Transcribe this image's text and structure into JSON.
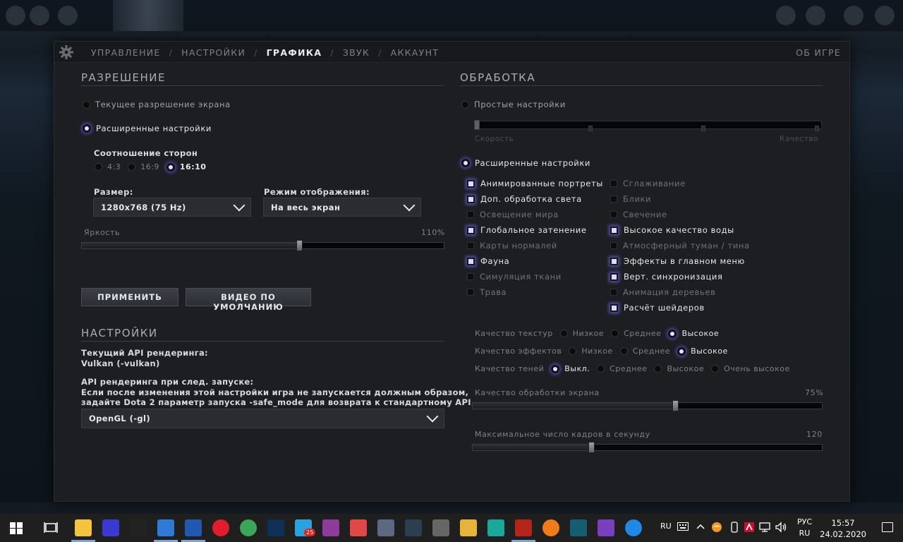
{
  "nav": {
    "tabs": [
      "УПРАВЛЕНИЕ",
      "НАСТРОЙКИ",
      "ГРАФИКА",
      "ЗВУК",
      "АККАУНТ"
    ],
    "active_tab": "ГРАФИКА",
    "about": "ОБ ИГРЕ"
  },
  "resolution": {
    "title": "РАЗРЕШЕНИЕ",
    "current_label": "Текущее разрешение экрана",
    "advanced_label": "Расширенные настройки",
    "aspect_label": "Соотношение сторон",
    "aspect_options": [
      "4:3",
      "16:9",
      "16:10"
    ],
    "aspect_selected": "16:10",
    "size_label": "Размер:",
    "size_value": "1280x768 (75 Hz)",
    "display_mode_label": "Режим отображения:",
    "display_mode_value": "На весь экран",
    "brightness_label": "Яркость",
    "brightness_value_text": "110%",
    "brightness_fraction": 0.6,
    "apply_button": "ПРИМЕНИТЬ",
    "default_video_button": "ВИДЕО ПО УМОЛЧАНИЮ"
  },
  "settings": {
    "title": "НАСТРОЙКИ",
    "current_api_label": "Текущий API рендеринга:",
    "current_api_value": "Vulkan (-vulkan)",
    "next_api_label": "API рендеринга при след. запуске:",
    "next_api_note_1": "Если после изменения этой настройки игра не запускается должным образом,",
    "next_api_note_2": "задайте Dota 2 параметр запуска -safe_mode для возврата к стандартному API.",
    "api_dropdown_value": "OpenGL (-gl)"
  },
  "processing": {
    "title": "ОБРАБОТКА",
    "simple_label": "Простые настройки",
    "speed_label": "Скорость",
    "quality_label": "Качество",
    "advanced_label": "Расширенные настройки",
    "checkboxes_left": [
      {
        "label": "Анимированные портреты",
        "checked": true
      },
      {
        "label": "Доп. обработка света",
        "checked": true
      },
      {
        "label": "Освещение мира",
        "checked": false
      },
      {
        "label": "Глобальное затенение",
        "checked": true
      },
      {
        "label": "Карты нормалей",
        "checked": false
      },
      {
        "label": "Фауна",
        "checked": true
      },
      {
        "label": "Симуляция ткани",
        "checked": false
      },
      {
        "label": "Трава",
        "checked": false
      }
    ],
    "checkboxes_right": [
      {
        "label": "Сглаживание",
        "checked": false
      },
      {
        "label": "Блики",
        "checked": false
      },
      {
        "label": "Свечение",
        "checked": false
      },
      {
        "label": "Высокое качество воды",
        "checked": true
      },
      {
        "label": "Атмосферный туман / тина",
        "checked": false
      },
      {
        "label": "Эффекты в главном меню",
        "checked": true
      },
      {
        "label": "Верт. синхронизация",
        "checked": true
      },
      {
        "label": "Анимация деревьев",
        "checked": false
      },
      {
        "label": "Расчёт шейдеров",
        "checked": true
      }
    ],
    "texture_quality": {
      "label": "Качество текстур",
      "options": [
        "Низкое",
        "Среднее",
        "Высокое"
      ],
      "selected": "Высокое"
    },
    "effects_quality": {
      "label": "Качество эффектов",
      "options": [
        "Низкое",
        "Среднее",
        "Высокое"
      ],
      "selected": "Высокое"
    },
    "shadow_quality": {
      "label": "Качество теней",
      "options": [
        "Выкл.",
        "Среднее",
        "Высокое",
        "Очень высокое"
      ],
      "selected": "Выкл."
    },
    "screen_quality_label": "Качество обработки экрана",
    "screen_quality_value_text": "75%",
    "screen_quality_fraction": 0.58,
    "max_fps_label": "Максимальное число кадров в секунду",
    "max_fps_value_text": "120",
    "max_fps_fraction": 0.34
  },
  "taskbar": {
    "lang_short": "RU",
    "lang_top": "РУС",
    "lang_bottom": "RU",
    "time": "15:57",
    "date": "24.02.2020",
    "badge_count": "25",
    "apps": [
      "file-explorer-icon",
      "hex-editor-icon",
      "penguin-icon",
      "network-icon",
      "grid-app-icon",
      "opera-icon",
      "chrome-icon",
      "photoshop-icon",
      "telegram-icon",
      "winrar-icon",
      "tool-icon",
      "calculator-icon",
      "atom-icon",
      "circle-app-icon",
      "triangle-app-icon",
      "3d-app-icon",
      "dota-icon",
      "orange-ball-icon",
      "3dsmax-icon",
      "bars-app-icon",
      "vscode-icon"
    ]
  }
}
